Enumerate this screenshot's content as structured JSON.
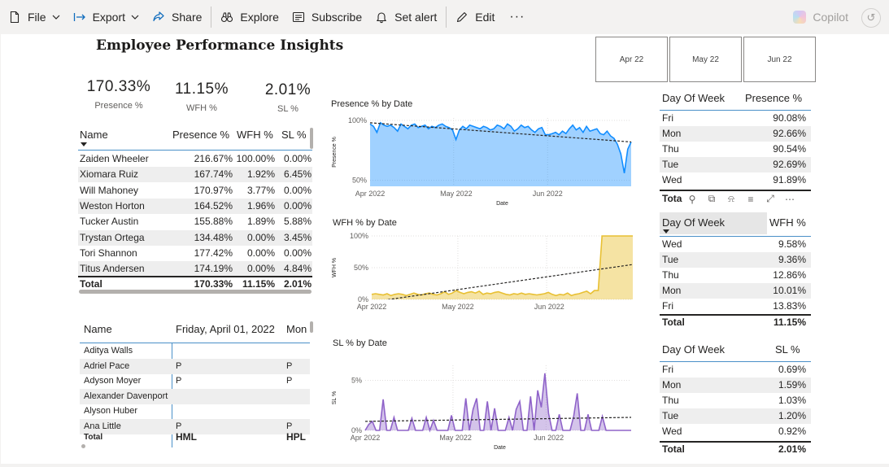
{
  "toolbar": {
    "file": "File",
    "export": "Export",
    "share": "Share",
    "explore": "Explore",
    "subscribe": "Subscribe",
    "set_alert": "Set alert",
    "edit": "Edit",
    "more": "···",
    "copilot": "Copilot"
  },
  "report": {
    "title": "Employee Performance Insights"
  },
  "slicer": {
    "tiles": [
      "Apr 22",
      "May 22",
      "Jun 22"
    ]
  },
  "kpis": [
    {
      "value": "170.33%",
      "label": "Presence %"
    },
    {
      "value": "11.15%",
      "label": "WFH %"
    },
    {
      "value": "2.01%",
      "label": "SL %"
    }
  ],
  "employee_table": {
    "columns": [
      "Name",
      "Presence %",
      "WFH %",
      "SL %"
    ],
    "rows": [
      [
        "Zaiden Wheeler",
        "216.67%",
        "100.00%",
        "0.00%"
      ],
      [
        "Xiomara Ruiz",
        "167.74%",
        "1.92%",
        "6.45%"
      ],
      [
        "Will Mahoney",
        "170.97%",
        "3.77%",
        "0.00%"
      ],
      [
        "Weston Horton",
        "164.52%",
        "1.96%",
        "0.00%"
      ],
      [
        "Tucker Austin",
        "155.88%",
        "1.89%",
        "5.88%"
      ],
      [
        "Trystan Ortega",
        "134.48%",
        "0.00%",
        "3.45%"
      ],
      [
        "Tori Shannon",
        "177.42%",
        "0.00%",
        "0.00%"
      ],
      [
        "Titus Andersen",
        "174.19%",
        "0.00%",
        "4.84%"
      ]
    ],
    "total": [
      "Total",
      "170.33%",
      "11.15%",
      "2.01%"
    ]
  },
  "attendance_matrix": {
    "columns": [
      "Name",
      "Friday, April 01, 2022",
      "Mon"
    ],
    "rows": [
      [
        "Aditya Walls",
        "",
        ""
      ],
      [
        "Adriel Pace",
        "P",
        "P"
      ],
      [
        "Adyson Moyer",
        "P",
        "P"
      ],
      [
        "Alexander Davenport",
        "",
        ""
      ],
      [
        "Alyson Huber",
        "",
        ""
      ],
      [
        "Ana Little",
        "P",
        "P"
      ]
    ],
    "total": [
      "Total",
      "HML",
      "HPL"
    ]
  },
  "day_tables": [
    {
      "columns": [
        "Day Of Week",
        "Presence %"
      ],
      "rows": [
        [
          "Fri",
          "90.08%"
        ],
        [
          "Mon",
          "92.66%"
        ],
        [
          "Thu",
          "90.54%"
        ],
        [
          "Tue",
          "92.69%"
        ],
        [
          "Wed",
          "91.89%"
        ]
      ],
      "total": [
        "Tota",
        ""
      ]
    },
    {
      "columns": [
        "Day Of Week",
        "WFH %"
      ],
      "rows": [
        [
          "Wed",
          "9.58%"
        ],
        [
          "Tue",
          "9.36%"
        ],
        [
          "Thu",
          "12.86%"
        ],
        [
          "Mon",
          "10.01%"
        ],
        [
          "Fri",
          "13.83%"
        ]
      ],
      "total": [
        "Total",
        "11.15%"
      ]
    },
    {
      "columns": [
        "Day Of Week",
        "SL %"
      ],
      "rows": [
        [
          "Fri",
          "0.69%"
        ],
        [
          "Mon",
          "1.59%"
        ],
        [
          "Thu",
          "1.03%"
        ],
        [
          "Tue",
          "1.20%"
        ],
        [
          "Wed",
          "0.92%"
        ]
      ],
      "total": [
        "Total",
        "2.01%"
      ]
    }
  ],
  "chart_data": [
    {
      "type": "area",
      "title": "Presence % by Date",
      "xlabel": "Date",
      "ylabel": "Presence %",
      "x_ticks": [
        "Apr 2022",
        "May 2022",
        "Jun 2022"
      ],
      "y_ticks": [
        "100%",
        "50%"
      ],
      "ylim": [
        45,
        102
      ],
      "trendline": [
        98,
        82
      ],
      "color": "#118DFF",
      "series": [
        {
          "values": [
            97,
            95,
            90,
            98,
            96,
            95,
            96,
            94,
            91,
            97,
            95,
            93,
            96,
            97,
            94,
            95,
            96,
            93,
            95,
            94,
            96,
            97,
            95,
            94,
            92,
            84,
            92,
            95,
            93,
            96,
            95,
            94,
            93,
            95,
            94,
            92,
            93,
            96,
            95,
            93,
            97,
            95,
            91,
            93,
            96,
            94,
            95,
            92,
            90,
            93,
            94,
            88,
            88,
            89,
            90,
            88,
            91,
            89,
            93,
            96,
            92,
            94,
            90,
            95,
            91,
            92,
            93,
            89,
            88,
            91,
            87,
            85,
            80,
            72,
            56,
            76,
            82
          ]
        }
      ]
    },
    {
      "type": "area",
      "title": "WFH % by Date",
      "xlabel": "Date",
      "ylabel": "WFH %",
      "x_ticks": [
        "Apr 2022",
        "May 2022",
        "Jun 2022"
      ],
      "y_ticks": [
        "100%",
        "50%",
        "0%"
      ],
      "ylim": [
        0,
        100
      ],
      "trendline": [
        -4,
        55
      ],
      "color": "#E8C033",
      "series": [
        {
          "values": [
            8,
            9,
            8,
            7,
            9,
            6,
            8,
            9,
            8,
            6,
            8,
            10,
            8,
            7,
            9,
            10,
            8,
            7,
            9,
            12,
            8,
            10,
            14,
            11,
            9,
            11,
            12,
            10,
            13,
            8,
            10,
            9,
            11,
            12,
            10,
            8,
            7,
            9,
            8,
            10,
            8,
            9,
            8,
            7,
            8,
            9,
            11,
            8,
            6,
            8,
            7,
            10,
            6,
            8,
            9,
            11,
            13,
            9,
            14,
            14,
            100,
            100,
            100,
            100,
            100,
            100,
            100,
            100,
            100
          ]
        }
      ]
    },
    {
      "type": "area",
      "title": "SL % by Date",
      "xlabel": "Date",
      "ylabel": "SL %",
      "x_ticks": [
        "Apr 2022",
        "May 2022",
        "Jun 2022"
      ],
      "y_ticks": [
        "5%",
        "0%"
      ],
      "ylim": [
        0,
        6.5
      ],
      "trendline": [
        0.9,
        1.3
      ],
      "color": "#8F63C9",
      "series": [
        {
          "values": [
            0,
            0.6,
            0.9,
            0,
            0,
            3.1,
            0,
            0,
            1.3,
            0,
            0,
            0,
            0,
            1.2,
            0,
            0,
            0,
            1.3,
            0,
            1.0,
            0,
            0,
            0,
            0,
            1.5,
            0,
            0,
            0,
            3.2,
            0,
            2.1,
            3.2,
            0,
            0,
            2.9,
            0,
            2.2,
            0,
            0,
            0,
            1.3,
            0,
            2.1,
            2.9,
            0,
            0,
            3.4,
            0,
            4.0,
            2.3,
            5.7,
            1.7,
            0,
            0,
            1.6,
            0,
            0,
            0,
            1.4,
            3.7,
            0,
            0,
            1.6,
            0,
            0,
            0,
            1.4,
            0,
            0,
            0,
            0,
            0,
            0,
            0,
            0
          ]
        }
      ]
    }
  ]
}
